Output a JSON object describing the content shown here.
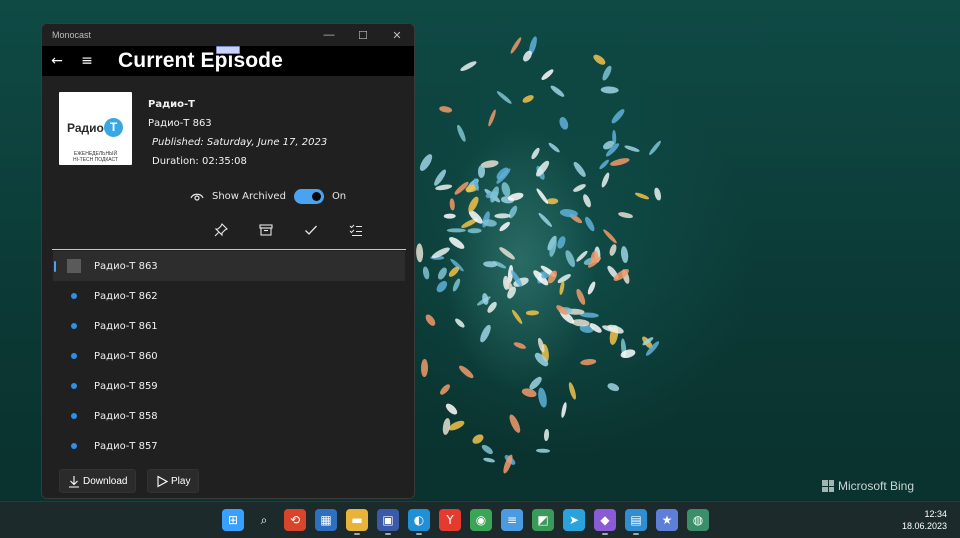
{
  "window": {
    "app_title": "Monocast",
    "controls": {
      "minimize": "—",
      "maximize": "☐",
      "close": "✕"
    }
  },
  "header": {
    "title": "Current Episode"
  },
  "episode": {
    "cover": {
      "logo_text": "Радио",
      "logo_letter": "Т",
      "subtitle_line1": "ЕЖЕНЕДЕЛЬНЫЙ",
      "subtitle_line2": "HI-TECH ПОДКАСТ"
    },
    "podcast": "Радио-Т",
    "title": "Радио-Т 863",
    "published": "Published: Saturday, June 17, 2023",
    "duration": "Duration:  02:35:08"
  },
  "archived": {
    "label": "Show Archived",
    "state": "On",
    "enabled": true
  },
  "episodes": [
    {
      "label": "Радио-Т 863",
      "selected": true
    },
    {
      "label": "Радио-Т 862"
    },
    {
      "label": "Радио-Т 861"
    },
    {
      "label": "Радио-Т 860"
    },
    {
      "label": "Радио-Т 859"
    },
    {
      "label": "Радио-Т 858"
    },
    {
      "label": "Радио-Т 857"
    }
  ],
  "buttons": {
    "download": "Download",
    "play": "Play"
  },
  "desktop": {
    "bing": "Microsoft Bing"
  },
  "taskbar": {
    "icons": [
      {
        "name": "start-icon",
        "glyph": "⊞",
        "color": "#3aa0ff"
      },
      {
        "name": "search-icon",
        "glyph": "⌕",
        "color": "transparent"
      },
      {
        "name": "remote-desktop-icon",
        "glyph": "⟲",
        "color": "#d9452b"
      },
      {
        "name": "store-icon",
        "glyph": "▦",
        "color": "#2f6fbf"
      },
      {
        "name": "file-explorer-icon",
        "glyph": "▬",
        "color": "#e8b339"
      },
      {
        "name": "save-app-icon",
        "glyph": "▣",
        "color": "#3a5aa8"
      },
      {
        "name": "edge-icon",
        "glyph": "◐",
        "color": "#1f8fd6"
      },
      {
        "name": "yandex-icon",
        "glyph": "Y",
        "color": "#e33b2e"
      },
      {
        "name": "chrome-icon",
        "glyph": "◉",
        "color": "#3aa655"
      },
      {
        "name": "notepad-icon",
        "glyph": "≡",
        "color": "#4b9be0"
      },
      {
        "name": "photos-icon",
        "glyph": "◩",
        "color": "#3a9a5a"
      },
      {
        "name": "telegram-icon",
        "glyph": "➤",
        "color": "#2aa3dd"
      },
      {
        "name": "visual-studio-icon",
        "glyph": "◆",
        "color": "#8a5bd6"
      },
      {
        "name": "app-icon",
        "glyph": "▤",
        "color": "#2e8ecf"
      },
      {
        "name": "bookmark-app-icon",
        "glyph": "★",
        "color": "#5d7fd8"
      },
      {
        "name": "globe-app-icon",
        "glyph": "◍",
        "color": "#3a8f6a"
      }
    ],
    "time": "12:34",
    "date": "18.06.2023"
  }
}
